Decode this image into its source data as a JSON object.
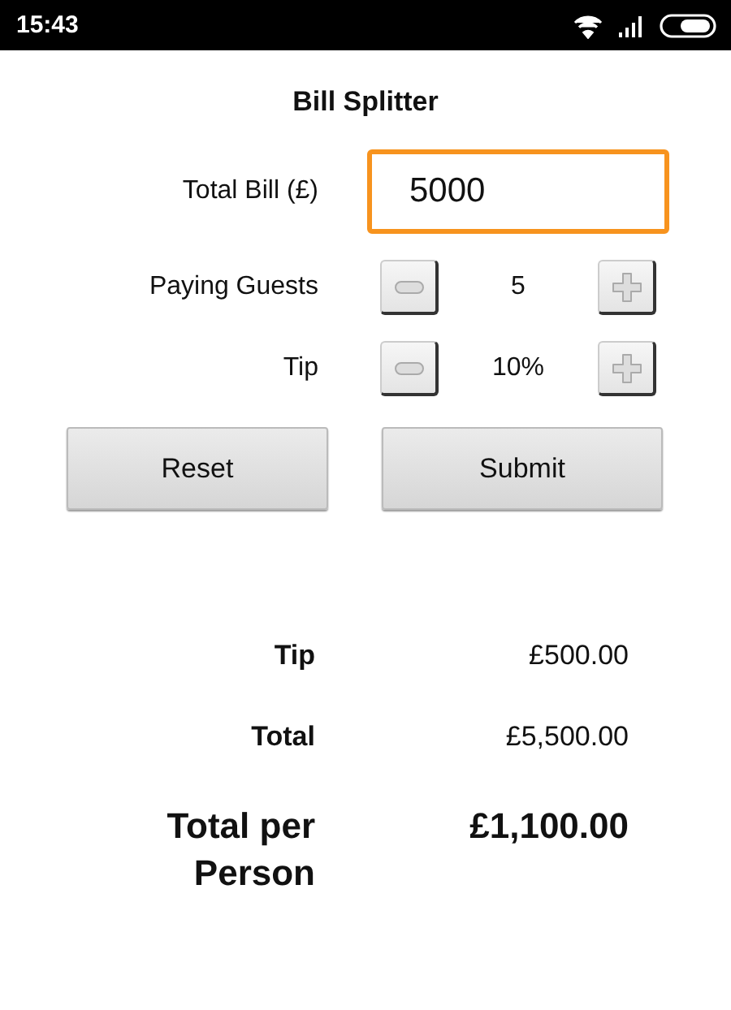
{
  "status_bar": {
    "time": "15:43"
  },
  "title": "Bill Splitter",
  "total_bill": {
    "label": "Total Bill (£)",
    "value": "5000",
    "focused": true
  },
  "steppers": [
    {
      "label": "Paying Guests",
      "value": "5"
    },
    {
      "label": "Tip",
      "value": "10%"
    }
  ],
  "buttons": [
    "Reset",
    "Submit"
  ],
  "results": [
    {
      "label": "Tip",
      "value": "£500.00",
      "kind": "normal"
    },
    {
      "label": "Total",
      "value": "£5,500.00",
      "kind": "normal"
    },
    {
      "label": "Total per Person",
      "value": "£1,100.00",
      "kind": "large"
    }
  ]
}
